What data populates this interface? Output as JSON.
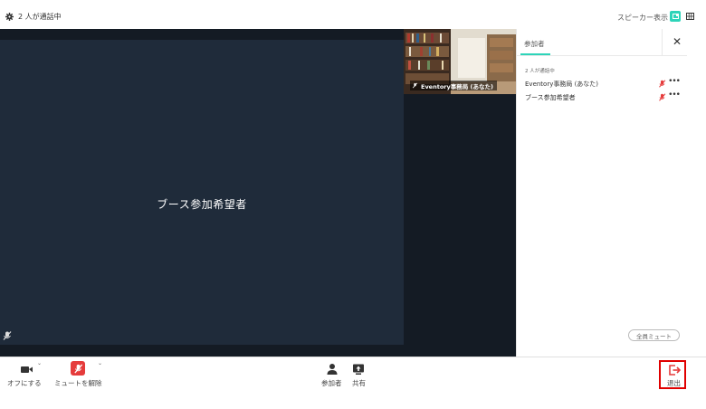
{
  "topbar": {
    "call_status": "2 人が通話中",
    "view_label": "スピーカー表示"
  },
  "stage": {
    "main_participant_name": "ブース参加希望者",
    "thumbnail_name": "Eventory事務局 (あなた)"
  },
  "panel": {
    "tab_label": "参加者",
    "close_label": "✕",
    "count_text": "2 人が通話中",
    "participants": [
      {
        "name": "Eventory事務局 (あなた)"
      },
      {
        "name": "ブース参加希望者"
      }
    ],
    "more_label": "•••",
    "mute_all_label": "全員ミュート"
  },
  "toolbar": {
    "camera_label": "オフにする",
    "mic_label": "ミュートを解除",
    "participants_label": "参加者",
    "share_label": "共有",
    "leave_label": "退出"
  },
  "colors": {
    "accent": "#2dd4b9",
    "mute_red": "#e53b3b",
    "stage_bg": "#141b24",
    "tile_bg": "#1f2b3a",
    "highlight": "#e00000"
  }
}
